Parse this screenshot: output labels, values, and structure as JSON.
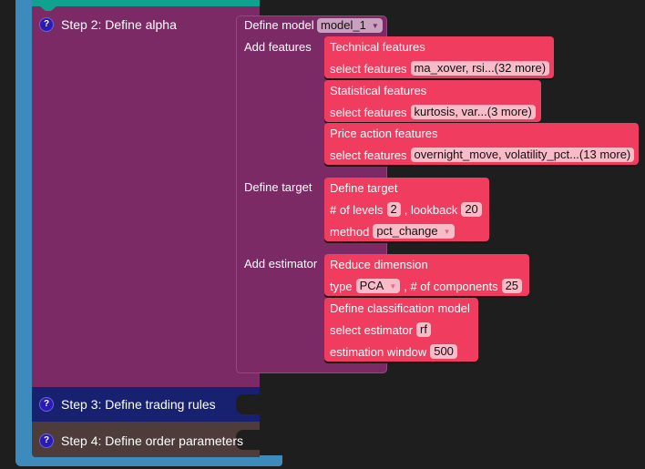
{
  "steps": {
    "step2": {
      "label": "Step 2: Define alpha",
      "help": "?"
    },
    "step3": {
      "label": "Step 3: Define trading rules",
      "help": "?"
    },
    "step4": {
      "label": "Step 4: Define order parameters",
      "help": "?"
    }
  },
  "model": {
    "define_label": "Define model",
    "model_value": "model_1",
    "add_features_label": "Add features",
    "define_target_label": "Define target",
    "add_estimator_label": "Add estimator"
  },
  "features": [
    {
      "title": "Technical features",
      "select_label": "select features",
      "value": "ma_xover, rsi...(32 more)"
    },
    {
      "title": "Statistical features",
      "select_label": "select features",
      "value": "kurtosis, var...(3 more)"
    },
    {
      "title": "Price action features",
      "select_label": "select features",
      "value": "overnight_move, volatility_pct...(13 more)"
    }
  ],
  "target": {
    "title": "Define target",
    "levels_label": "# of levels",
    "levels_value": "2",
    "lookback_label": ", lookback",
    "lookback_value": "20",
    "method_label": "method",
    "method_value": "pct_change"
  },
  "reduce": {
    "title": "Reduce dimension",
    "type_label": "type",
    "type_value": "PCA",
    "components_label": ", # of components",
    "components_value": "25"
  },
  "classifier": {
    "title": "Define classification model",
    "estimator_label": "select estimator",
    "estimator_value": "rf",
    "window_label": "estimation window",
    "window_value": "500"
  },
  "colors": {
    "step2": "#7b2a66",
    "step3": "#172170",
    "step4": "#4d3c3a",
    "frame": "#3d8bbd",
    "teal": "#0fa38f",
    "feature_block": "#f03c5f"
  }
}
